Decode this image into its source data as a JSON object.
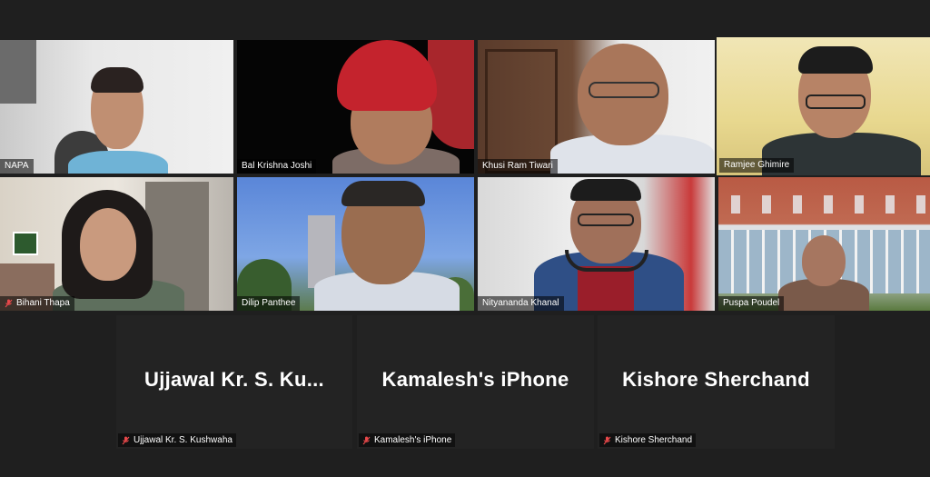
{
  "participants": [
    {
      "name": "NAPA",
      "muted": false,
      "active": false
    },
    {
      "name": "Bal Krishna Joshi",
      "muted": false,
      "active": false
    },
    {
      "name": "Khusi Ram Tiwari",
      "muted": false,
      "active": false
    },
    {
      "name": "Ramjee Ghimire",
      "muted": false,
      "active": true
    },
    {
      "name": "Bihani Thapa",
      "muted": true,
      "active": false
    },
    {
      "name": "Dilip Panthee",
      "muted": false,
      "active": false
    },
    {
      "name": "Nityananda Khanal",
      "muted": false,
      "active": false
    },
    {
      "name": "Puspa Poudel",
      "muted": false,
      "active": false
    }
  ],
  "audio_only": [
    {
      "display": "Ujjawal  Kr.  S.  Ku...",
      "name": "Ujjawal Kr. S. Kushwaha",
      "muted": true
    },
    {
      "display": "Kamalesh's iPhone",
      "name": "Kamalesh's iPhone",
      "muted": true
    },
    {
      "display": "Kishore Sherchand",
      "name": "Kishore Sherchand",
      "muted": true
    }
  ],
  "colors": {
    "active_speaker_border": "#d7ea4a",
    "mute_icon": "#e8484a",
    "background": "#1f1f1f"
  }
}
